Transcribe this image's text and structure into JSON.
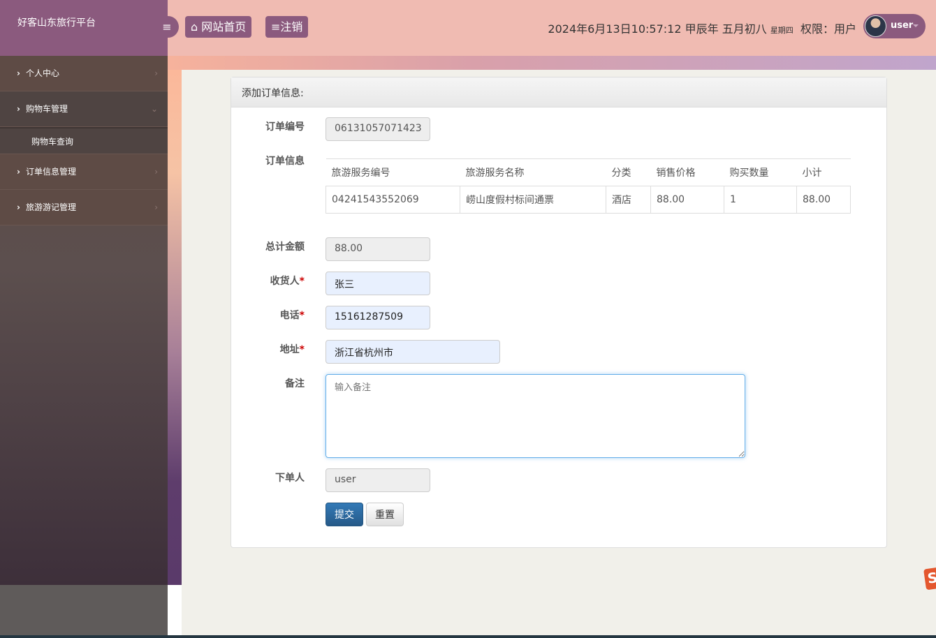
{
  "app": {
    "title": "好客山东旅行平台"
  },
  "header": {
    "home_label": "网站首页",
    "logout_label": "注销",
    "datetime": "2024年6月13日10:57:12 甲辰年 五月初八",
    "weekday": "星期四",
    "permission": "权限：用户",
    "username": "user"
  },
  "sidebar": {
    "items": [
      {
        "label": "个人中心"
      },
      {
        "label": "购物车管理",
        "children": [
          {
            "label": "购物车查询"
          }
        ]
      },
      {
        "label": "订单信息管理"
      },
      {
        "label": "旅游游记管理"
      }
    ]
  },
  "form": {
    "title": "添加订单信息:",
    "order_no_label": "订单编号",
    "order_no": "06131057071423",
    "order_info_label": "订单信息",
    "table": {
      "headers": [
        "旅游服务编号",
        "旅游服务名称",
        "分类",
        "销售价格",
        "购买数量",
        "小计"
      ],
      "rows": [
        [
          "04241543552069",
          "崂山度假村标间通票",
          "酒店",
          "88.00",
          "1",
          "88.00"
        ]
      ]
    },
    "total_label": "总计金额",
    "total": "88.00",
    "receiver_label": "收货人",
    "receiver": "张三",
    "phone_label": "电话",
    "phone": "15161287509",
    "address_label": "地址",
    "address": "浙江省杭州市",
    "remark_label": "备注",
    "remark_placeholder": "输入备注",
    "orderer_label": "下单人",
    "orderer": "user",
    "required_mark": "*",
    "submit_label": "提交",
    "reset_label": "重置"
  }
}
